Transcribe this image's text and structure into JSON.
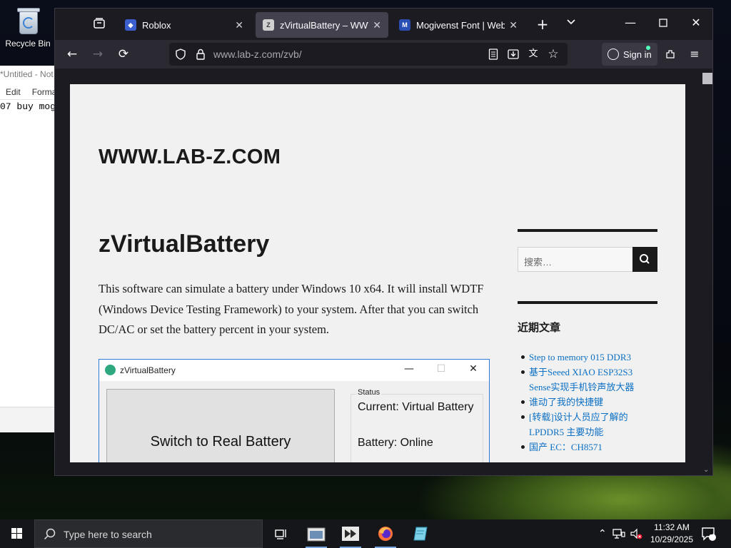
{
  "desktop": {
    "recycle_bin_label": "Recycle Bin"
  },
  "notepad": {
    "title": "*Untitled - Not",
    "menu": [
      "Edit",
      "Forma"
    ],
    "text": "07 buy mog"
  },
  "browser": {
    "tabs": [
      {
        "label": "Roblox",
        "favicon": "roblox-icon",
        "active": false
      },
      {
        "label": "zVirtualBattery – WWW.L",
        "favicon": "lab-z-icon",
        "active": true
      },
      {
        "label": "Mogivenst Font | Webfon",
        "favicon": "webfont-icon",
        "active": false
      }
    ],
    "address": "www.lab-z.com/zvb/",
    "sign_in_label": "Sign in"
  },
  "page": {
    "site_title": "WWW.LAB-Z.COM",
    "post_title": "zVirtualBattery",
    "post_body": "This software can simulate a battery under Windows 10 x64. It will install WDTF (Windows Device Testing Framework) to your system. After that you can switch DC/AC or set the battery percent in your system.",
    "screenshot": {
      "window_title": "zVirtualBattery",
      "button_label": "Switch to Real Battery",
      "status_title": "Status",
      "status_current": "Current: Virtual Battery",
      "status_battery": "Battery: Online"
    },
    "sidebar": {
      "search_placeholder": "搜索…",
      "recent_heading": "近期文章",
      "recent_posts": [
        "Step to memory 015 DDR3",
        "基于Seeed XIAO ESP32S3",
        "Sense实现手机铃声放大器",
        "谁动了我的快捷键",
        "[转载]设计人员应了解的",
        "LPDDR5 主要功能",
        "国产 EC：CH8571"
      ]
    }
  },
  "taskbar": {
    "search_placeholder": "Type here to search",
    "time": "11:32 AM",
    "date": "10/29/2025",
    "notification_count": "1"
  },
  "colors": {
    "browser_chrome": "#1c1b22",
    "toolbar": "#2b2a33",
    "link": "#0b6fc4",
    "page_bg": "#f1f1f1"
  }
}
